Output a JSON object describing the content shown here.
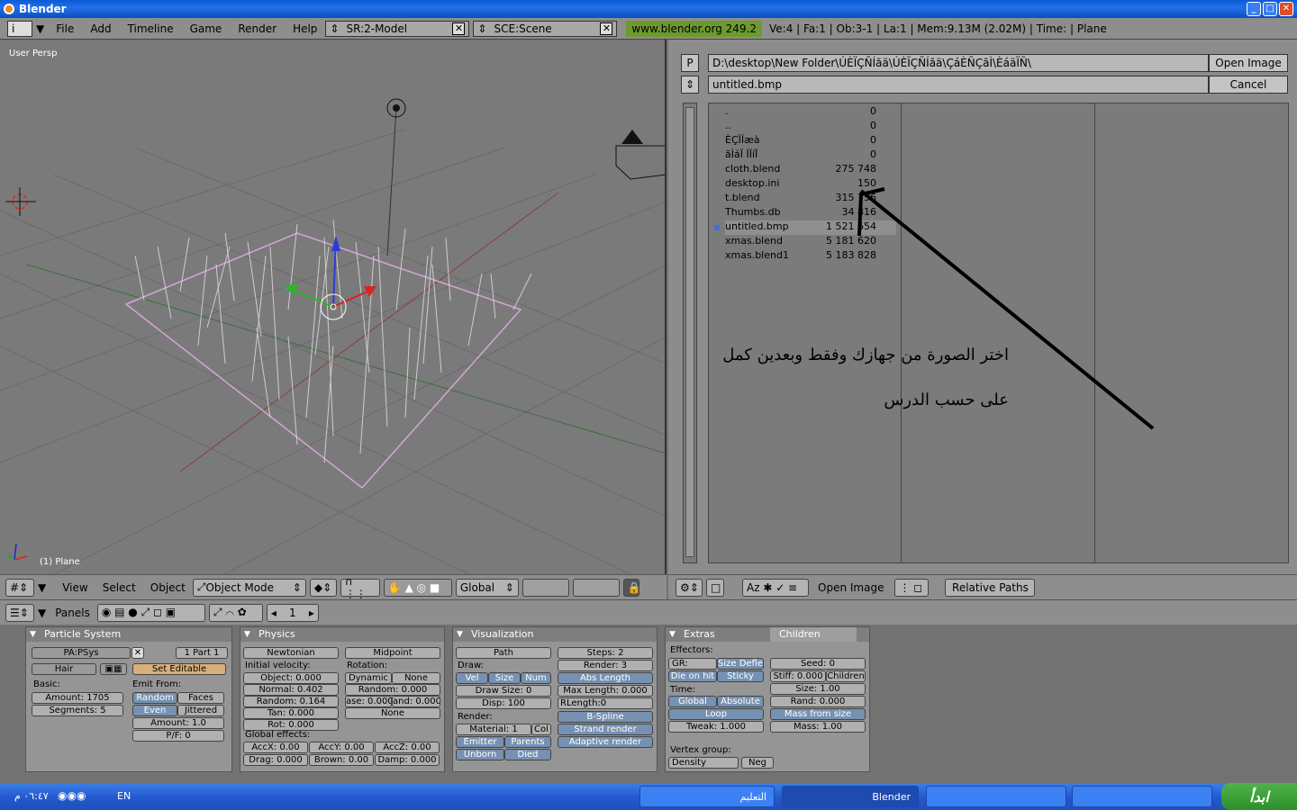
{
  "window": {
    "title": "Blender"
  },
  "infobar": {
    "menus": [
      "File",
      "Add",
      "Timeline",
      "Game",
      "Render",
      "Help"
    ],
    "screen": "SR:2-Model",
    "scene": "SCE:Scene",
    "link": "www.blender.org 249.2",
    "stats": "Ve:4 | Fa:1 | Ob:3-1 | La:1  | Mem:9.13M (2.02M)  | Time: | Plane"
  },
  "viewport": {
    "label": "User Persp",
    "object": "(1) Plane",
    "header": {
      "menus": [
        "View",
        "Select",
        "Object"
      ],
      "mode": "Object Mode",
      "orient": "Global"
    }
  },
  "filebrowser": {
    "dir": "D:\\desktop\\New Folder\\ÚÈÏÇÑÍãä\\ÚÈÏÇÑÍãä\\ÇáÈÑÇãÌ\\ÈáäÏÑ\\",
    "file": "untitled.bmp",
    "open_label": "Open Image",
    "cancel_label": "Cancel",
    "p_label": "P",
    "files": [
      {
        "name": ".",
        "size": "0"
      },
      {
        "name": "..",
        "size": "0"
      },
      {
        "name": "ÈÇÏÍæà",
        "size": "0"
      },
      {
        "name": "ãÌáÏ ÌÏíÏ",
        "size": "0"
      },
      {
        "name": "cloth.blend",
        "size": "275 748"
      },
      {
        "name": "desktop.ini",
        "size": "150"
      },
      {
        "name": "t.blend",
        "size": "315 756"
      },
      {
        "name": "Thumbs.db",
        "size": "34 816"
      },
      {
        "name": "untitled.bmp",
        "size": "1 521 654",
        "selected": true
      },
      {
        "name": "xmas.blend",
        "size": "5 181 620"
      },
      {
        "name": "xmas.blend1",
        "size": "5 183 828"
      }
    ],
    "note_line1": "اختر الصورة من جهازك وفقط وبعدين كمل",
    "note_line2": "على حسب الدرس",
    "footer": {
      "open_label": "Open Image",
      "relative": "Relative Paths"
    }
  },
  "props": {
    "panels_label": "Panels",
    "frame": "1",
    "particle": {
      "title": "Particle System",
      "name": "PA:PSys",
      "part": "1 Part 1",
      "type": "Hair",
      "set_editable": "Set Editable",
      "basic": "Basic:",
      "amount": "Amount: 1705",
      "segments": "Segments: 5",
      "emit_from": "Emit From:",
      "random": "Random",
      "faces": "Faces",
      "even": "Even",
      "jittered": "Jittered",
      "amount2": "Amount: 1.0",
      "pf": "P/F: 0"
    },
    "physics": {
      "title": "Physics",
      "phys": "Newtonian",
      "integr": "Midpoint",
      "init_vel": "Initial velocity:",
      "object": "Object: 0.000",
      "normal": "Normal: 0.402",
      "random": "Random: 0.164",
      "tan": "Tan: 0.000",
      "rot": "Rot: 0.000",
      "rotation": "Rotation:",
      "dynamic": "Dynamic",
      "none1": "None",
      "rand_rot": "Random: 0.000",
      "phase": "ase: 0.000",
      "rand_ph": "and: 0.000",
      "none2": "None",
      "global": "Global effects:",
      "accx": "AccX: 0.00",
      "accy": "AccY: 0.00",
      "accz": "AccZ: 0.00",
      "drag": "Drag: 0.000",
      "brown": "Brown: 0.00",
      "damp": "Damp: 0.000"
    },
    "vis": {
      "title": "Visualization",
      "type": "Path",
      "steps": "Steps: 2",
      "draw": "Draw:",
      "render_s": "Render: 3",
      "vel": "Vel",
      "size": "Size",
      "num": "Num",
      "abs": "Abs Length",
      "draw_size": "Draw Size: 0",
      "maxlen": "Max Length: 0.000",
      "disp": "Disp: 100",
      "rlen": "RLength:0",
      "render": "Render:",
      "bspline": "B-Spline",
      "material": "Material: 1",
      "col": "Col",
      "strand": "Strand render",
      "emitter": "Emitter",
      "parents": "Parents",
      "adaptive": "Adaptive render",
      "unborn": "Unborn",
      "died": "Died"
    },
    "extras": {
      "tab1": "Extras",
      "tab2": "Children",
      "effectors": "Effectors:",
      "gr": "GR:",
      "size_defl": "Size Defle",
      "die": "Die on hit",
      "sticky": "Sticky",
      "seed": "Seed: 0",
      "stiff": "Stiff: 0.000",
      "children": "Children",
      "time": "Time:",
      "size": "Size: 1.00",
      "global": "Global",
      "absolute": "Absolute",
      "rand": "Rand: 0.000",
      "loop": "Loop",
      "mass_size": "Mass from size",
      "tweak": "Tweak: 1.000",
      "mass": "Mass: 1.00",
      "vgroup": "Vertex group:",
      "density": "Density",
      "neg": "Neg"
    }
  },
  "taskbar": {
    "start": "ابدأ",
    "lang": "EN",
    "clock": "٠٦:٤٧ م",
    "items": [
      "Blender",
      "التعليم"
    ]
  }
}
